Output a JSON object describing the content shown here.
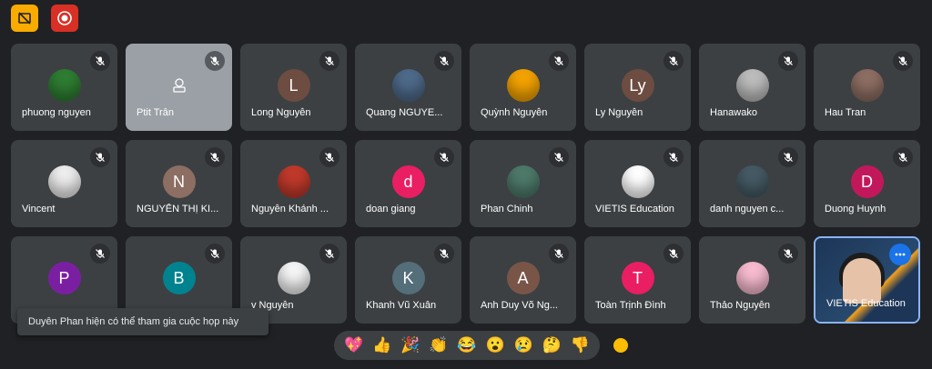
{
  "toolbar": {
    "captions_icon": "captions-off-icon",
    "record_icon": "record-icon"
  },
  "colors": {
    "background": "#202124",
    "tile": "#3c4043",
    "accent_blue": "#1a73e8",
    "record_red": "#d93025",
    "captions_yellow": "#f9ab00"
  },
  "participants": [
    {
      "name": "phuong nguyen",
      "initial": "",
      "avatar_color": "#2e7d32"
    },
    {
      "name": "Ptit Trân",
      "initial": "",
      "avatar_color": ""
    },
    {
      "name": "Long Nguyễn",
      "initial": "L",
      "avatar_color": "#6d4c41"
    },
    {
      "name": "Quang NGUYE...",
      "initial": "",
      "avatar_color": "#4e6a8a"
    },
    {
      "name": "Quỳnh Nguyễn",
      "initial": "",
      "avatar_color": "#f4a300"
    },
    {
      "name": "Ly Nguyễn",
      "initial": "Ly",
      "avatar_color": "#6d4c41"
    },
    {
      "name": "Hanawako",
      "initial": "",
      "avatar_color": "#bdbdbd"
    },
    {
      "name": "Hau Tran",
      "initial": "",
      "avatar_color": "#8d6e63"
    },
    {
      "name": "Vincent",
      "initial": "",
      "avatar_color": "#eeeeee"
    },
    {
      "name": "NGUYỄN THỊ KI...",
      "initial": "N",
      "avatar_color": "#8d6e63"
    },
    {
      "name": "Nguyễn Khánh ...",
      "initial": "",
      "avatar_color": "#c0392b"
    },
    {
      "name": "doan giang",
      "initial": "d",
      "avatar_color": "#e91e63"
    },
    {
      "name": "Phan Chinh",
      "initial": "",
      "avatar_color": "#4e7a6a"
    },
    {
      "name": "VIETIS Education",
      "initial": "",
      "avatar_color": "#ffffff"
    },
    {
      "name": "danh nguyen c...",
      "initial": "",
      "avatar_color": "#455a64"
    },
    {
      "name": "Duong Huynh",
      "initial": "D",
      "avatar_color": "#c2185b"
    },
    {
      "name": "",
      "initial": "P",
      "avatar_color": "#7b1fa2"
    },
    {
      "name": "",
      "initial": "B",
      "avatar_color": "#00838f"
    },
    {
      "name": "y Nguyễn",
      "initial": "",
      "avatar_color": "#f5f5f5"
    },
    {
      "name": "Khanh Vũ Xuân",
      "initial": "K",
      "avatar_color": "#546e7a"
    },
    {
      "name": "Anh Duy Võ Ng...",
      "initial": "A",
      "avatar_color": "#795548"
    },
    {
      "name": "Toàn Trịnh Đình",
      "initial": "T",
      "avatar_color": "#e91e63"
    },
    {
      "name": "Thảo Nguyễn",
      "initial": "",
      "avatar_color": "#f8bbd0"
    },
    {
      "name": "VIETIS Education",
      "initial": "",
      "avatar_color": ""
    }
  ],
  "toast": {
    "message": "Duyên Phan hiện có thể tham gia cuộc họp này"
  },
  "reactions": [
    "💖",
    "👍",
    "🎉",
    "👏",
    "😂",
    "😮",
    "😢",
    "🤔",
    "👎"
  ],
  "skin_tone_icon": "skin-tone-icon"
}
